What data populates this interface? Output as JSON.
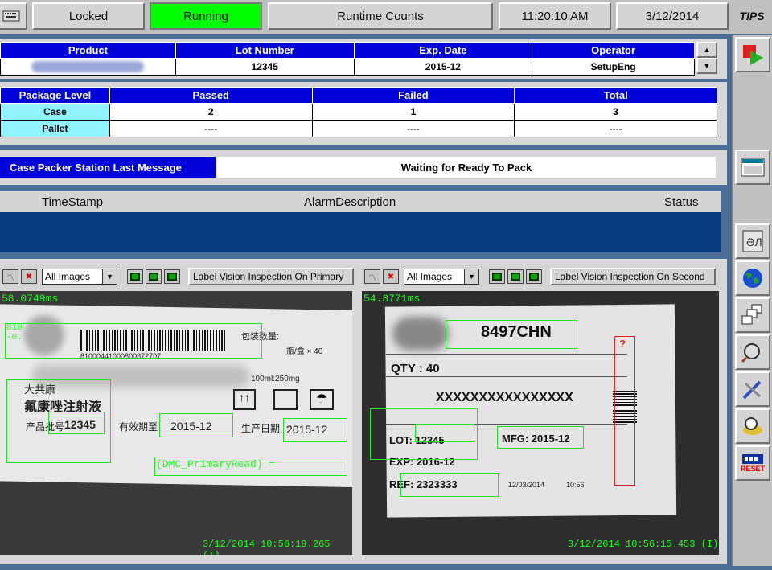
{
  "topbar": {
    "locked": "Locked",
    "running": "Running",
    "runtime_counts": "Runtime Counts",
    "time": "11:20:10 AM",
    "date": "3/12/2014",
    "logo": "TIPS"
  },
  "product_table": {
    "headers": [
      "Product",
      "Lot Number",
      "Exp. Date",
      "Operator"
    ],
    "row": {
      "lot": "12345",
      "exp": "2015-12",
      "operator": "SetupEng"
    }
  },
  "package_table": {
    "headers": [
      "Package Level",
      "Passed",
      "Failed",
      "Total"
    ],
    "rows": [
      {
        "level": "Case",
        "passed": "2",
        "failed": "1",
        "total": "3"
      },
      {
        "level": "Pallet",
        "passed": "----",
        "failed": "----",
        "total": "----"
      }
    ]
  },
  "message": {
    "label": "Case Packer Station Last Message",
    "text": "Waiting for Ready To Pack"
  },
  "alarms": {
    "headers": [
      "TimeStamp",
      "AlarmDescription",
      "Status"
    ]
  },
  "camera_left": {
    "dropdown": "All Images",
    "title": "Label Vision Inspection On Primary",
    "time_ms": "58.0749ms",
    "timestamp": "3/12/2014 10:56:19.265 (I)",
    "texts": {
      "code_left": "810",
      "code_neg": "-0.",
      "barcode_digits": "81000441000800872707",
      "spec_a": "包装数量:",
      "spec_b": "瓶/盒 × 40",
      "dose": "100ml:250mg",
      "brand": "大共康",
      "drug": "氟康唑注射液",
      "lot_prefix": "产品批号",
      "lot_value": "12345",
      "exp_prefix": "有效期至",
      "exp_value": "2015-12",
      "mfg_prefix": "生产日期",
      "mfg_value": "2015-12",
      "dmc": "(DMC_PrimaryRead) ="
    }
  },
  "camera_right": {
    "dropdown": "All Images",
    "title": "Label Vision Inspection On Second",
    "time_ms": "54.8771ms",
    "timestamp": "3/12/2014 10:56:15.453 (I)",
    "texts": {
      "code": "8497CHN",
      "qty": "QTY : 40",
      "masked": "XXXXXXXXXXXXXXXX",
      "lot": "LOT: 12345",
      "mfg": "MFG: 2015-12",
      "exp": "EXP: 2016-12",
      "ref": "REF: 2323333",
      "date_small": "12/03/2014",
      "time_small": "10:56",
      "question": "?"
    }
  },
  "sidebar": {
    "reset": "RESET"
  },
  "colors": {
    "running": "#00ff00",
    "header_blue": "#0000d8",
    "cyan_label": "#8ff4ff",
    "overlay_green": "#1cff1c"
  }
}
